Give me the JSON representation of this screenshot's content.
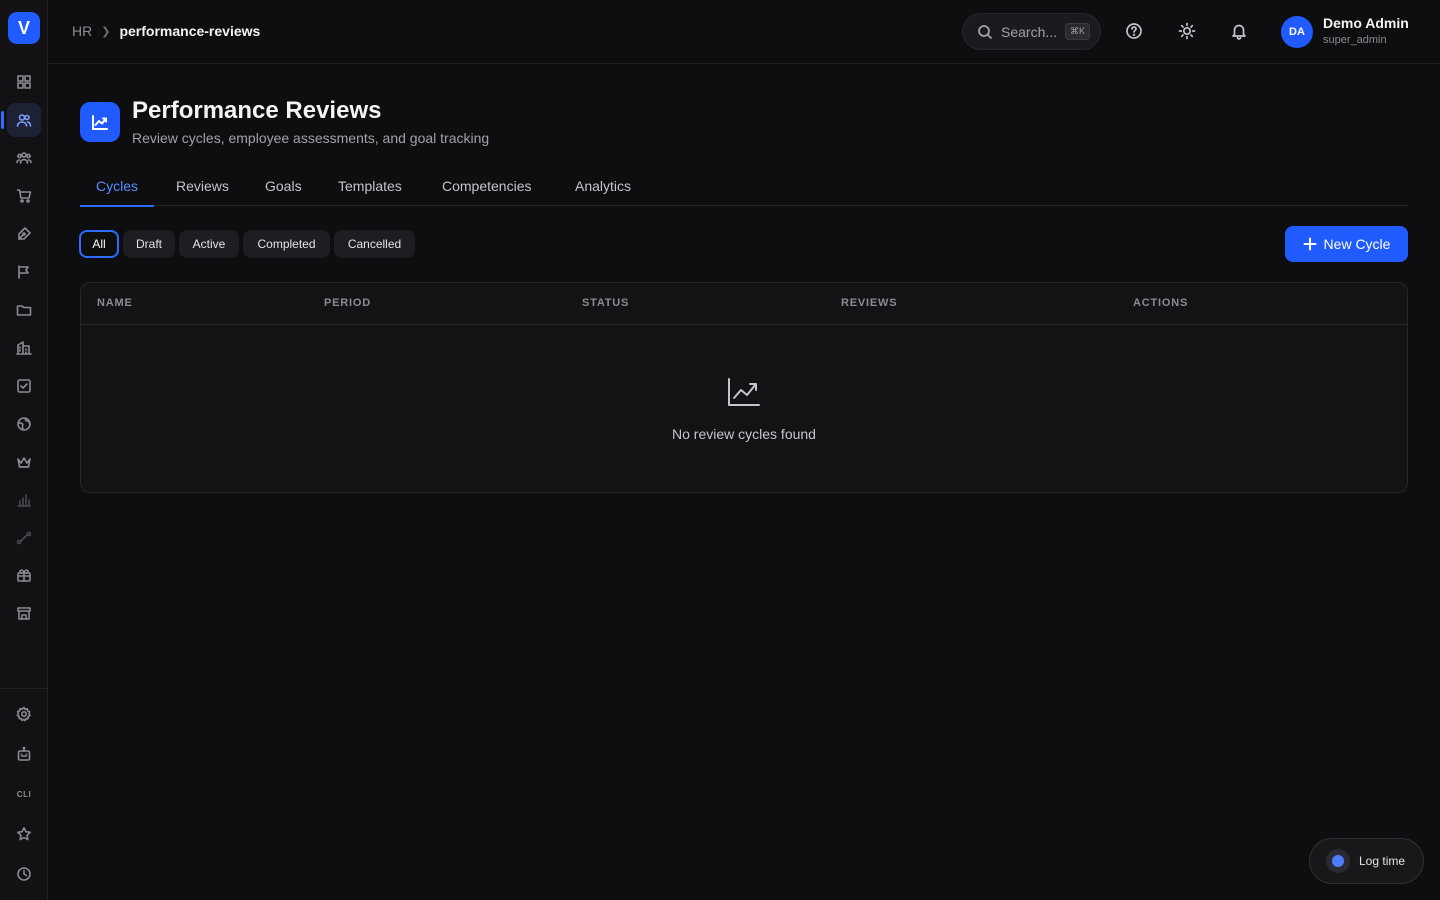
{
  "sidebar": {
    "logo": "V",
    "cli_label": "CLI"
  },
  "topbar": {
    "breadcrumb_root": "HR",
    "breadcrumb_current": "performance-reviews",
    "search_placeholder": "Search...",
    "search_shortcut": "⌘K",
    "user": {
      "initials": "DA",
      "name": "Demo Admin",
      "role": "super_admin"
    }
  },
  "header": {
    "title": "Performance Reviews",
    "subtitle": "Review cycles, employee assessments, and goal tracking"
  },
  "tabs": [
    {
      "label": "Cycles",
      "active": true
    },
    {
      "label": "Reviews"
    },
    {
      "label": "Goals"
    },
    {
      "label": "Templates"
    },
    {
      "label": "Competencies"
    },
    {
      "label": "Analytics"
    }
  ],
  "filters": [
    {
      "label": "All",
      "active": true
    },
    {
      "label": "Draft"
    },
    {
      "label": "Active"
    },
    {
      "label": "Completed"
    },
    {
      "label": "Cancelled"
    }
  ],
  "new_button_label": "New Cycle",
  "table": {
    "columns": [
      "NAME",
      "PERIOD",
      "STATUS",
      "REVIEWS",
      "ACTIONS"
    ],
    "empty_message": "No review cycles found"
  },
  "log_time_label": "Log time",
  "colors": {
    "accent": "#1f5bff",
    "background": "#0e0e10"
  }
}
